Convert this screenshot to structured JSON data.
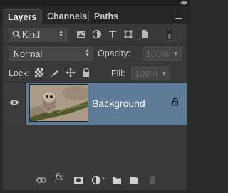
{
  "tabs": [
    {
      "label": "Layers",
      "active": true
    },
    {
      "label": "Channels",
      "active": false
    },
    {
      "label": "Paths",
      "active": false
    }
  ],
  "filter": {
    "kind_label": "Kind",
    "icons": [
      "image-filter-icon",
      "adjustment-filter-icon",
      "type-filter-icon",
      "shape-filter-icon",
      "smart-object-filter-icon"
    ]
  },
  "blend_mode": {
    "value": "Normal"
  },
  "opacity": {
    "label": "Opacity:",
    "value": "100%"
  },
  "lock": {
    "label": "Lock:",
    "icons": [
      "lock-transparent-pixels-icon",
      "lock-image-pixels-icon",
      "lock-position-icon",
      "lock-all-icon"
    ]
  },
  "fill": {
    "label": "Fill:",
    "value": "100%"
  },
  "layers": [
    {
      "name": "Background",
      "visible": true,
      "locked": true,
      "selected": true
    }
  ],
  "bottom_icons": [
    "link-layers-icon",
    "fx-icon",
    "add-mask-icon",
    "adjustment-layer-icon",
    "new-group-icon",
    "new-layer-icon",
    "delete-layer-icon"
  ],
  "colors": {
    "panel_bg": "#393939",
    "selected_layer": "#5e7b98",
    "input_bg": "#454545"
  }
}
